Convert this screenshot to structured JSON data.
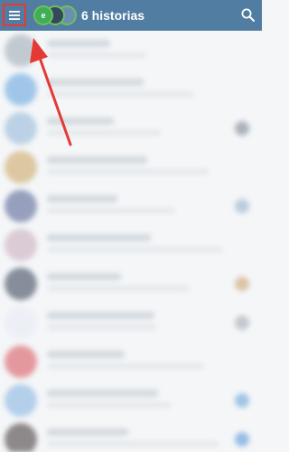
{
  "topbar": {
    "title": "6 historias",
    "avatar_letter": "e"
  },
  "icons": {
    "menu": "menu-icon",
    "search": "search-icon",
    "annotation": "red-arrow-annotation"
  },
  "colors": {
    "topbar": "#527da3",
    "highlight": "#e53935"
  },
  "chat_rows": [
    {
      "avatar_color": "#9aa7b3",
      "side_color": ""
    },
    {
      "avatar_color": "#5aa0de",
      "side_color": ""
    },
    {
      "avatar_color": "#8fb4d6",
      "side_color": "#6e7a86"
    },
    {
      "avatar_color": "#c9a25a",
      "side_color": ""
    },
    {
      "avatar_color": "#4a5a8e",
      "side_color": "#8ea9c6"
    },
    {
      "avatar_color": "#c7a9b9",
      "side_color": ""
    },
    {
      "avatar_color": "#2e3a50",
      "side_color": "#c79a62"
    },
    {
      "avatar_color": "#e7eaf5",
      "side_color": "#9aa3ab"
    },
    {
      "avatar_color": "#d84d55",
      "side_color": ""
    },
    {
      "avatar_color": "#7fb0e0",
      "side_color": "#5b9ad6"
    },
    {
      "avatar_color": "#3a3030",
      "side_color": "#4a8ed4"
    }
  ]
}
